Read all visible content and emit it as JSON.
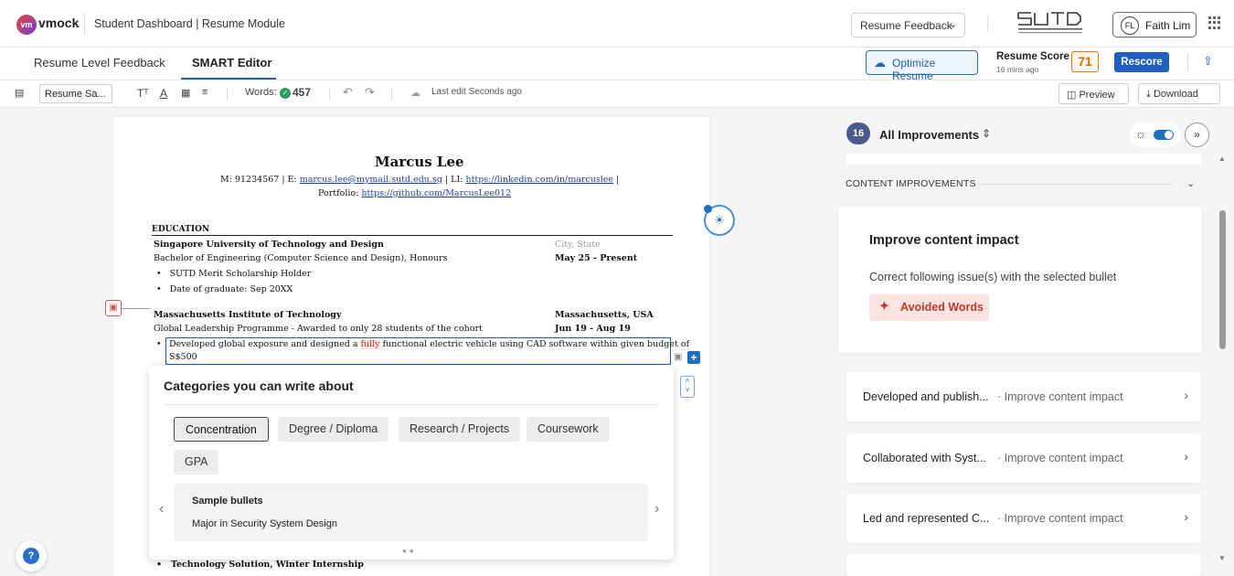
{
  "header": {
    "logo_mark": "vm",
    "logo_text": "vmock",
    "breadcrumb": "Student Dashboard | Resume Module",
    "feedback_dropdown": "Resume Feedback",
    "user_initials": "FL",
    "user_name": "Faith Lim"
  },
  "tabs": [
    {
      "label": "Resume Level Feedback",
      "active": false
    },
    {
      "label": "SMART Editor",
      "active": true
    }
  ],
  "score": {
    "optimize_label": "Optimize Resume",
    "label": "Resume Score",
    "updated": "16 mins ago",
    "value": "71",
    "rescore_label": "Rescore"
  },
  "toolbar": {
    "resume_name": "Resume Sa...",
    "words_label": "Words:",
    "words_count": "457",
    "last_edit": "Last edit Seconds ago",
    "preview_label": "Preview",
    "download_label": "Download"
  },
  "resume": {
    "name": "Marcus Lee",
    "contact_prefix": "M: 91234567 | E:",
    "email": "marcus.lee@mymail.sutd.edu.sg",
    "li_prefix": "| LI:",
    "linkedin": "https://linkedin.com/in/marcuslee",
    "li_suffix": "|",
    "portfolio_prefix": "Portfolio:",
    "portfolio": "https://github.com/MarcusLee012",
    "section_education": "EDUCATION",
    "school1": "Singapore University of Technology and Design",
    "school1_loc": "City, State",
    "degree1": "Bachelor of Engineering (Computer Science and Design), Honours",
    "degree1_date": "May 25 - Present",
    "bullet1": "SUTD Merit Scholarship Holder",
    "bullet2": "Date of graduate: Sep 20XX",
    "school2": "Massachusetts Institute of Technology",
    "school2_loc": "Massachusetts, USA",
    "program2": "Global Leadership Programme - Awarded to only 28 students of the cohort",
    "program2_date": "Jun 19 - Aug 19",
    "sel_bullet_a": "Developed global exposure and designed a ",
    "sel_bullet_hl": "fully",
    "sel_bullet_b": " functional electric vehicle using CAD software within given budget of",
    "sel_bullet_c": "S$500",
    "bottom_bullet": "Technology Solution, Winter Internship"
  },
  "categories": {
    "title": "Categories you can write about",
    "chips": [
      "Concentration",
      "Degree / Diploma",
      "Research / Projects",
      "Coursework",
      "GPA"
    ],
    "selected": "Concentration",
    "sample_title": "Sample bullets",
    "sample_text": "Major in Security System Design"
  },
  "improvements": {
    "count": "16",
    "title": "All Improvements",
    "section_label": "CONTENT IMPROVEMENTS",
    "main_title": "Improve content impact",
    "main_sub": "Correct following issue(s) with the selected bullet",
    "issue_tag": "Avoided Words",
    "items": [
      {
        "bullet": "Developed and publish...",
        "type": "· Improve content impact"
      },
      {
        "bullet": "Collaborated with Syst...",
        "type": "· Improve content impact"
      },
      {
        "bullet": "Led and represented C...",
        "type": "· Improve content impact"
      }
    ]
  },
  "colors": {
    "primary": "#1f5fbf",
    "score_orange": "#d46b0b",
    "issue_red": "#c0392b",
    "badge": "#4a5a8c"
  }
}
